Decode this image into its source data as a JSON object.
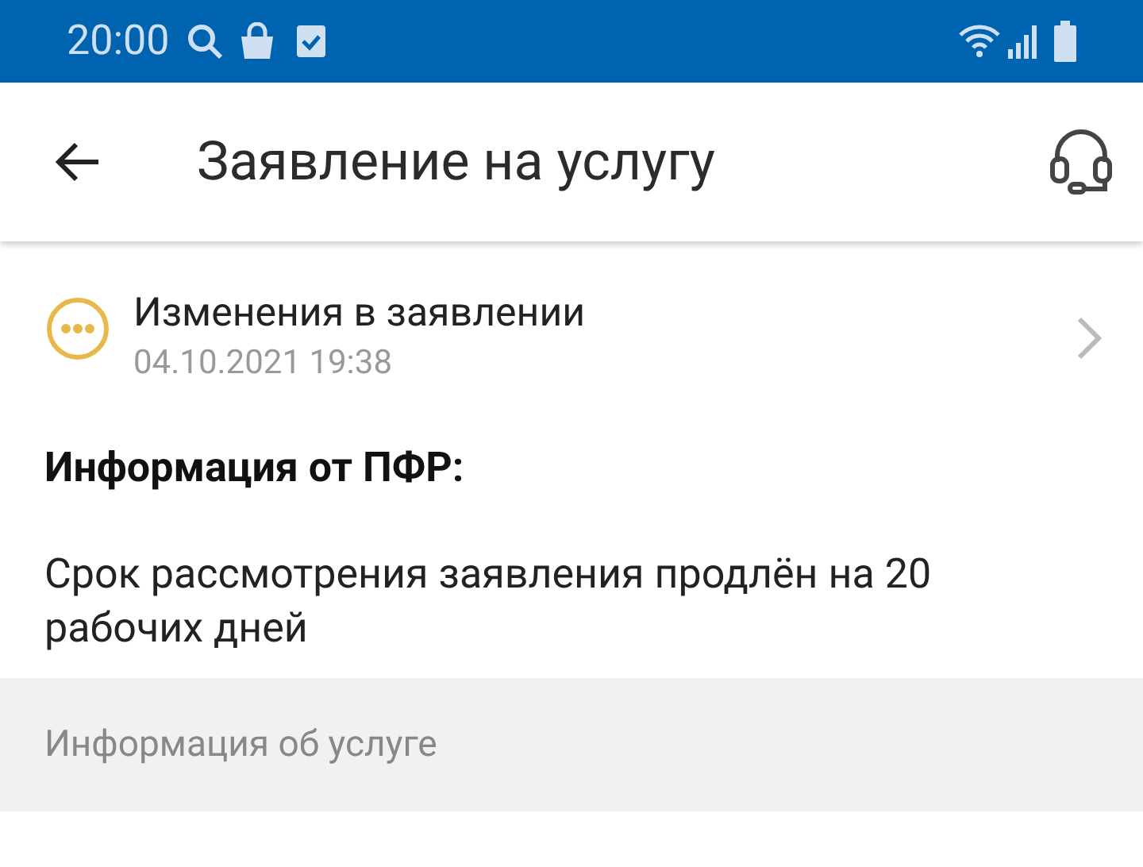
{
  "status_bar": {
    "time": "20:00"
  },
  "app_bar": {
    "title": "Заявление на услугу"
  },
  "status_item": {
    "title": "Изменения в заявлении",
    "date": "04.10.2021 19:38",
    "color": "#e8b84a"
  },
  "info": {
    "heading": "Информация от ПФР:",
    "text": "Срок рассмотрения заявления продлён на 20 рабочих дней"
  },
  "section": {
    "title": "Информация об услуге"
  }
}
